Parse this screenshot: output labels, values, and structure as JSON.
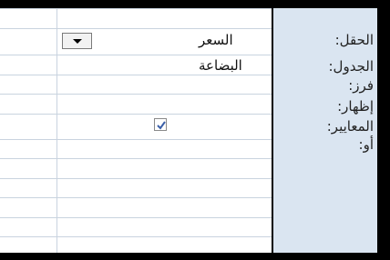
{
  "colors": {
    "grid_background": "#ffffff",
    "grid_lines": "#c9d3df",
    "label_panel": "#dae5f1",
    "border": "#000000"
  },
  "labels": {
    "field": "الحقل:",
    "table": "الجدول:",
    "sort": "فرز:",
    "show": "إظهار:",
    "criteria": "المعايير:",
    "or": "أو:"
  },
  "column": {
    "field_value": "السعر",
    "table_value": "البضاعة",
    "show_checked": true,
    "dropdown_icon": "chevron-down-icon",
    "checkbox_icon": "checkmark-icon"
  }
}
